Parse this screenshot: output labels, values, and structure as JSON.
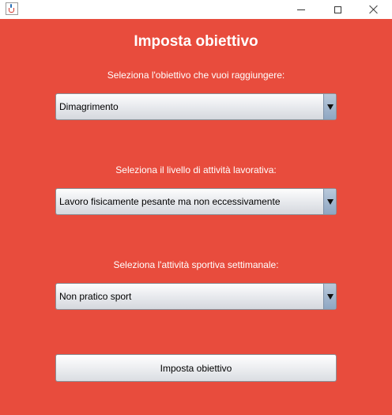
{
  "window": {
    "app_icon": "java-cup-icon",
    "controls": {
      "minimize": "minimize-icon",
      "maximize": "maximize-icon",
      "close": "close-icon"
    }
  },
  "colors": {
    "background": "#e84c3d",
    "text": "#ffffff"
  },
  "form": {
    "title": "Imposta obiettivo",
    "goal": {
      "label": "Seleziona l'obiettivo che vuoi raggiungere:",
      "selected": "Dimagrimento"
    },
    "work_activity": {
      "label": "Seleziona il livello di attività lavorativa:",
      "selected": "Lavoro fisicamente pesante ma non eccessivamente"
    },
    "sport_activity": {
      "label": "Seleziona l'attività sportiva settimanale:",
      "selected": "Non pratico sport"
    },
    "submit_label": "Imposta obiettivo"
  }
}
